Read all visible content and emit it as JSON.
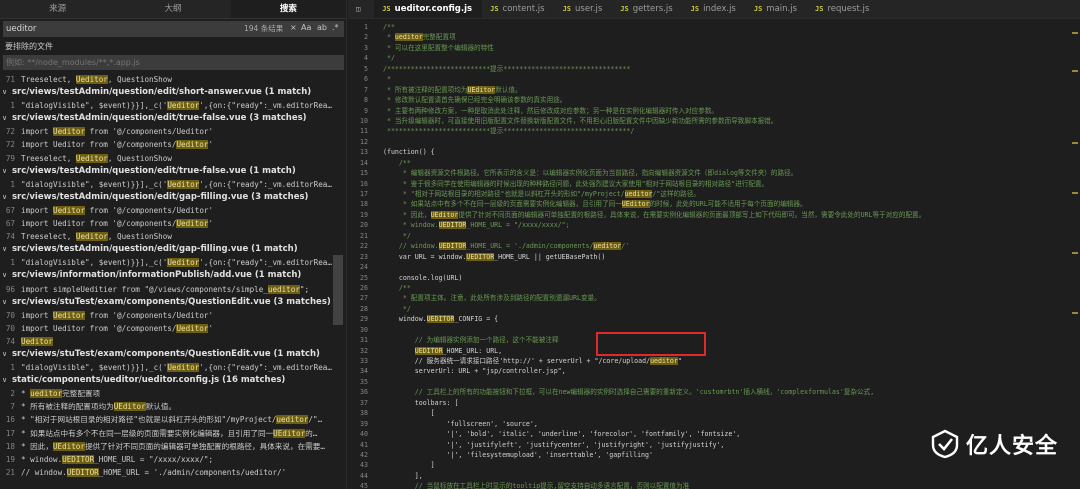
{
  "left": {
    "tabs": [
      "来源",
      "大纲",
      "搜索"
    ],
    "search": {
      "value": "ueditor",
      "count": "194 条结果"
    },
    "search_icons": {
      "clear": "×",
      "case": "Aa",
      "whole_word": "ab",
      "regex": ".*"
    },
    "exclude_label": "要排除的文件",
    "exclude_value": "例如: **/node_modules/**,*.app.js",
    "results": [
      {
        "type": "match",
        "line": "71",
        "parts": [
          "Treeselect, ",
          {
            "h": "Ueditor"
          },
          ", QuestionShow"
        ]
      },
      {
        "type": "file",
        "parts": [
          "src/views/testAdmin/question/edit/short-answer.vue (1 match)"
        ]
      },
      {
        "type": "match",
        "line": "1",
        "parts": [
          "\"dialogVisible\", $event)}}],_c('",
          {
            "h": "Ueditor"
          },
          "',{on:{\"ready\":_vm.editorRea…"
        ]
      },
      {
        "type": "file",
        "parts": [
          "src/views/testAdmin/question/edit/true-false.vue (3 matches)"
        ]
      },
      {
        "type": "match",
        "line": "72",
        "parts": [
          "import ",
          {
            "h": "Ueditor"
          },
          " from '@/components/Ueditor'"
        ]
      },
      {
        "type": "match",
        "line": "72",
        "parts": [
          "import Ueditor from '@/components/",
          {
            "h": "Ueditor"
          },
          "'"
        ]
      },
      {
        "type": "match",
        "line": "79",
        "parts": [
          "Treeselect, ",
          {
            "h": "Ueditor"
          },
          ", QuestionShow"
        ]
      },
      {
        "type": "file",
        "parts": [
          "src/views/testAdmin/question/edit/true-false.vue (1 match)"
        ]
      },
      {
        "type": "match",
        "line": "1",
        "parts": [
          "\"dialogVisible\", $event)}}],_c('",
          {
            "h": "Ueditor"
          },
          "',{on:{\"ready\":_vm.editorRea…"
        ]
      },
      {
        "type": "file",
        "parts": [
          "src/views/testAdmin/question/edit/gap-filling.vue (3 matches)"
        ]
      },
      {
        "type": "match",
        "line": "67",
        "parts": [
          "import ",
          {
            "h": "Ueditor"
          },
          " from '@/components/Ueditor'"
        ]
      },
      {
        "type": "match",
        "line": "67",
        "parts": [
          "import Ueditor from '@/components/",
          {
            "h": "Ueditor"
          },
          "'"
        ]
      },
      {
        "type": "match",
        "line": "74",
        "parts": [
          "Treeselect, ",
          {
            "h": "Ueditor"
          },
          ", QuestionShow"
        ]
      },
      {
        "type": "file",
        "parts": [
          "src/views/testAdmin/question/edit/gap-filling.vue (1 match)"
        ]
      },
      {
        "type": "match",
        "line": "1",
        "parts": [
          "\"dialogVisible\", $event)}}],_c('",
          {
            "h": "Ueditor"
          },
          "',{on:{\"ready\":_vm.editorRea…"
        ]
      },
      {
        "type": "file",
        "parts": [
          "src/views/information/informationPublish/add.vue (1 match)"
        ]
      },
      {
        "type": "match",
        "line": "96",
        "parts": [
          "import simpleUeditier from \"@/views/components/simple_",
          {
            "h": "ueditor"
          },
          "\";"
        ]
      },
      {
        "type": "file",
        "parts": [
          "src/views/stuTest/exam/components/QuestionEdit.vue (3 matches)"
        ]
      },
      {
        "type": "match",
        "line": "70",
        "parts": [
          "import ",
          {
            "h": "Ueditor"
          },
          " from '@/components/Ueditor'"
        ]
      },
      {
        "type": "match",
        "line": "70",
        "parts": [
          "import Ueditor from '@/components/",
          {
            "h": "Ueditor"
          },
          "'"
        ]
      },
      {
        "type": "match",
        "line": "74",
        "parts": [
          {
            "h": "Ueditor"
          }
        ]
      },
      {
        "type": "file",
        "parts": [
          "src/views/stuTest/exam/components/QuestionEdit.vue (1 match)"
        ]
      },
      {
        "type": "match",
        "line": "1",
        "parts": [
          "\"dialogVisible\", $event)}}],_c('",
          {
            "h": "Ueditor"
          },
          "',{on:{\"ready\":_vm.editorRea…"
        ]
      },
      {
        "type": "file",
        "parts": [
          "static/components/ueditor/ueditor.config.js (16 matches)"
        ]
      },
      {
        "type": "match",
        "line": "2",
        "parts": [
          "* ",
          {
            "h": "ueditor"
          },
          "完整配置项"
        ]
      },
      {
        "type": "match",
        "line": "7",
        "parts": [
          "* 所有被注释的配置项均为",
          {
            "h": "UEditor"
          },
          "默认值。"
        ]
      },
      {
        "type": "match",
        "line": "16",
        "parts": [
          "* \"相对于网站根目录的相对路径\"也就是以斜杠开头的形如\"/myProject/",
          {
            "h": "ueditor"
          },
          "/\"…"
        ]
      },
      {
        "type": "match",
        "line": "17",
        "parts": [
          "* 如果站点中有多个不在同一层级的页面需要实例化编辑器，且引用了同一",
          {
            "h": "UEditor"
          },
          "的…"
        ]
      },
      {
        "type": "match",
        "line": "18",
        "parts": [
          "* 因此，",
          {
            "h": "UEditor"
          },
          "提供了针对不同页面的编辑器可单独配置的根路径，具体来说，在需要…"
        ]
      },
      {
        "type": "match",
        "line": "19",
        "parts": [
          "* window.",
          {
            "h": "UEDITOR"
          },
          "_HOME_URL = \"/xxxx/xxxx/\";"
        ]
      },
      {
        "type": "match",
        "line": "21",
        "parts": [
          "// window.",
          {
            "h": "UEDITOR"
          },
          "_HOME_URL = './admin/components/ueditor/'"
        ]
      }
    ]
  },
  "editor": {
    "tabs": [
      {
        "icon": "JS",
        "label": "ueditor.config.js",
        "active": true
      },
      {
        "icon": "JS",
        "label": "content.js",
        "active": false
      },
      {
        "icon": "JS",
        "label": "user.js",
        "active": false
      },
      {
        "icon": "JS",
        "label": "getters.js",
        "active": false
      },
      {
        "icon": "JS",
        "label": "index.js",
        "active": false
      },
      {
        "icon": "JS",
        "label": "main.js",
        "active": false
      },
      {
        "icon": "JS",
        "label": "request.js",
        "active": false
      }
    ],
    "lines": [
      {
        "n": "1",
        "c": true,
        "parts": [
          "/**"
        ]
      },
      {
        "n": "2",
        "c": true,
        "parts": [
          " * ",
          {
            "h": "ueditor"
          },
          "完整配置项"
        ]
      },
      {
        "n": "3",
        "c": true,
        "parts": [
          " * 可以在这里配置整个编辑器的特性"
        ]
      },
      {
        "n": "4",
        "c": true,
        "parts": [
          " */"
        ]
      },
      {
        "n": "5",
        "c": true,
        "parts": [
          "/**************************提示********************************"
        ]
      },
      {
        "n": "6",
        "c": true,
        "parts": [
          " *"
        ]
      },
      {
        "n": "7",
        "c": true,
        "parts": [
          " * 所有被注释的配置项均为",
          {
            "h": "UEditor"
          },
          "默认值。"
        ]
      },
      {
        "n": "8",
        "c": true,
        "parts": [
          " * 修改默认配置请首先确保已经完全明确该参数的真实用途。"
        ]
      },
      {
        "n": "9",
        "c": true,
        "parts": [
          " * 主要有两种修改方案，一种是取消此处注释，然后修改成对应参数；另一种是在实例化编辑器时传入对应参数。"
        ]
      },
      {
        "n": "10",
        "c": true,
        "parts": [
          " * 当升级编辑器时，可直接使用旧版配置文件替换新版配置文件，不用担心旧版配置文件中因缺少新功能所需的参数而导致脚本报错。"
        ]
      },
      {
        "n": "11",
        "c": true,
        "parts": [
          " **************************提示********************************/"
        ]
      },
      {
        "n": "12",
        "c": false,
        "parts": [
          ""
        ]
      },
      {
        "n": "13",
        "c": false,
        "parts": [
          "(function() {"
        ]
      },
      {
        "n": "14",
        "c": true,
        "parts": [
          "    /**"
        ]
      },
      {
        "n": "15",
        "c": true,
        "parts": [
          "     * 编辑器资源文件根路径。它所表示的含义是：以编辑器实例化页面为当前路径，指向编辑器资源文件（即dialog等文件夹）的路径。"
        ]
      },
      {
        "n": "16",
        "c": true,
        "parts": [
          "     * 鉴于很多同学在使用编辑器的时候出现的种种路径问题，此处强烈建议大家使用\"相对于网站根目录的相对路径\"进行配置。"
        ]
      },
      {
        "n": "17",
        "c": true,
        "parts": [
          "     * \"相对于网站根目录的相对路径\"也就是以斜杠开头的形如\"/myProject/",
          {
            "h": "ueditor"
          },
          "/\"这样的路径。"
        ]
      },
      {
        "n": "18",
        "c": true,
        "parts": [
          "     * 如果站点中有多个不在同一层级的页面需要实例化编辑器，且引用了同一",
          {
            "h": "UEditor"
          },
          "的时候，此处的URL可能不适用于每个页面的编辑器。"
        ]
      },
      {
        "n": "19",
        "c": true,
        "parts": [
          "     * 因此，",
          {
            "h": "UEditor"
          },
          "提供了针对不同页面的编辑器可单独配置的根路径，具体来说，在需要实例化编辑器的页面最顶部写上如下代码即可。当然，需要令此处的URL等于对应的配置。"
        ]
      },
      {
        "n": "20",
        "c": true,
        "parts": [
          "     * window.",
          {
            "h": "UEDITOR"
          },
          "_HOME_URL = \"/xxxx/xxxx/\";"
        ]
      },
      {
        "n": "21",
        "c": true,
        "parts": [
          "     */"
        ]
      },
      {
        "n": "22",
        "c": true,
        "parts": [
          "    // window.",
          {
            "h": "UEDITOR"
          },
          "_HOME_URL = './admin/components/",
          {
            "h": "ueditor"
          },
          "/'"
        ]
      },
      {
        "n": "23",
        "c": false,
        "parts": [
          "    var URL = window.",
          {
            "h": "UEDITOR"
          },
          "_HOME_URL || getUEBasePath()"
        ]
      },
      {
        "n": "24",
        "c": false,
        "parts": [
          ""
        ]
      },
      {
        "n": "25",
        "c": false,
        "parts": [
          "    console.log(URL)"
        ]
      },
      {
        "n": "26",
        "c": true,
        "parts": [
          "    /**"
        ]
      },
      {
        "n": "27",
        "c": true,
        "parts": [
          "     * 配置项主体。注意，此处所有涉及到路径的配置别遗漏URL变量。"
        ]
      },
      {
        "n": "28",
        "c": true,
        "parts": [
          "     */"
        ]
      },
      {
        "n": "29",
        "c": false,
        "parts": [
          "    window.",
          {
            "h": "UEDITOR"
          },
          "_CONFIG = {"
        ]
      },
      {
        "n": "30",
        "c": false,
        "parts": [
          ""
        ]
      },
      {
        "n": "31",
        "c": true,
        "parts": [
          "        // 为编辑器实例添加一个路径，这个不能被注释"
        ]
      },
      {
        "n": "32",
        "c": false,
        "parts": [
          "        ",
          {
            "h": "UEDITOR"
          },
          "_HOME_URL: URL,"
        ]
      },
      {
        "n": "33",
        "c": false,
        "parts": [
          "        // 服务器统一请求接口路径'http://' + serverUrl + \"/core/upload/",
          {
            "h": "ueditor"
          },
          "\""
        ]
      },
      {
        "n": "34",
        "c": false,
        "parts": [
          "        serverUrl: URL + \"jsp/controller.jsp\","
        ]
      },
      {
        "n": "35",
        "c": false,
        "parts": [
          ""
        ]
      },
      {
        "n": "36",
        "c": true,
        "parts": [
          "        // 工具栏上的所有的功能按钮和下拉框，可以在new编辑器的实例时选择自己需要的重新定义。'customrbtn'插入横线，'complexformulas'复杂公式,"
        ]
      },
      {
        "n": "37",
        "c": false,
        "parts": [
          "        toolbars: ["
        ]
      },
      {
        "n": "38",
        "c": false,
        "parts": [
          "            ["
        ]
      },
      {
        "n": "39",
        "c": false,
        "parts": [
          "                'fullscreen', 'source',"
        ]
      },
      {
        "n": "40",
        "c": false,
        "parts": [
          "                '|', 'bold', 'italic', 'underline', 'forecolor', 'fontfamily', 'fontsize',"
        ]
      },
      {
        "n": "41",
        "c": false,
        "parts": [
          "                '|', 'justifyleft', 'justifycenter', 'justifyright', 'justifyjustify',"
        ]
      },
      {
        "n": "42",
        "c": false,
        "parts": [
          "                '|', 'filesystemupload', 'inserttable', 'gapfilling'"
        ]
      },
      {
        "n": "43",
        "c": false,
        "parts": [
          "            ]"
        ]
      },
      {
        "n": "44",
        "c": false,
        "parts": [
          "        ],"
        ]
      },
      {
        "n": "45",
        "c": true,
        "parts": [
          "        // 当鼠标放在工具栏上时显示的tooltip提示,留空支持自动多语言配置，否则以配置值为准"
        ]
      },
      {
        "n": "46",
        "c": false,
        "parts": [
          "    { }"
        ]
      }
    ]
  },
  "watermark": "亿人安全"
}
